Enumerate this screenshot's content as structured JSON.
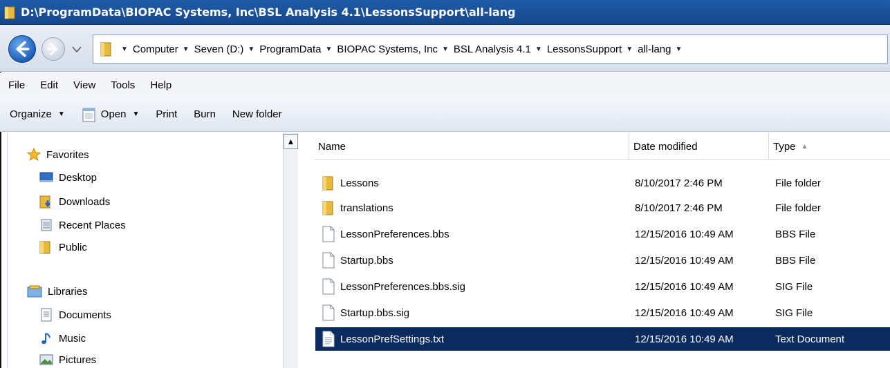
{
  "window": {
    "title": "D:\\ProgramData\\BIOPAC Systems, Inc\\BSL Analysis 4.1\\LessonsSupport\\all-lang"
  },
  "address_bar": {
    "crumbs": [
      "Computer",
      "Seven (D:)",
      "ProgramData",
      "BIOPAC Systems, Inc",
      "BSL Analysis 4.1",
      "LessonsSupport",
      "all-lang"
    ]
  },
  "menu": {
    "file": "File",
    "edit": "Edit",
    "view": "View",
    "tools": "Tools",
    "help": "Help"
  },
  "commands": {
    "organize": "Organize",
    "open": "Open",
    "print": "Print",
    "burn": "Burn",
    "new_folder": "New folder"
  },
  "nav_pane": {
    "favorites": {
      "label": "Favorites",
      "items": [
        "Desktop",
        "Downloads",
        "Recent Places",
        "Public"
      ]
    },
    "libraries": {
      "label": "Libraries",
      "items": [
        "Documents",
        "Music",
        "Pictures"
      ]
    }
  },
  "columns": {
    "name": "Name",
    "date": "Date modified",
    "type": "Type"
  },
  "files": [
    {
      "name": "Lessons",
      "date": "8/10/2017 2:46 PM",
      "type": "File folder",
      "icon": "folder-icon"
    },
    {
      "name": "translations",
      "date": "8/10/2017 2:46 PM",
      "type": "File folder",
      "icon": "folder-icon"
    },
    {
      "name": "LessonPreferences.bbs",
      "date": "12/15/2016 10:49 AM",
      "type": "BBS File",
      "icon": "file-icon"
    },
    {
      "name": "Startup.bbs",
      "date": "12/15/2016 10:49 AM",
      "type": "BBS File",
      "icon": "file-icon"
    },
    {
      "name": "LessonPreferences.bbs.sig",
      "date": "12/15/2016 10:49 AM",
      "type": "SIG File",
      "icon": "file-icon"
    },
    {
      "name": "Startup.bbs.sig",
      "date": "12/15/2016 10:49 AM",
      "type": "SIG File",
      "icon": "file-icon"
    },
    {
      "name": "LessonPrefSettings.txt",
      "date": "12/15/2016 10:49 AM",
      "type": "Text Document",
      "icon": "text-file-icon",
      "selected": true
    }
  ],
  "colors": {
    "titlebar": "#1f5ca8",
    "selection": "#0b2a5e",
    "folder": "#e8b93c"
  }
}
